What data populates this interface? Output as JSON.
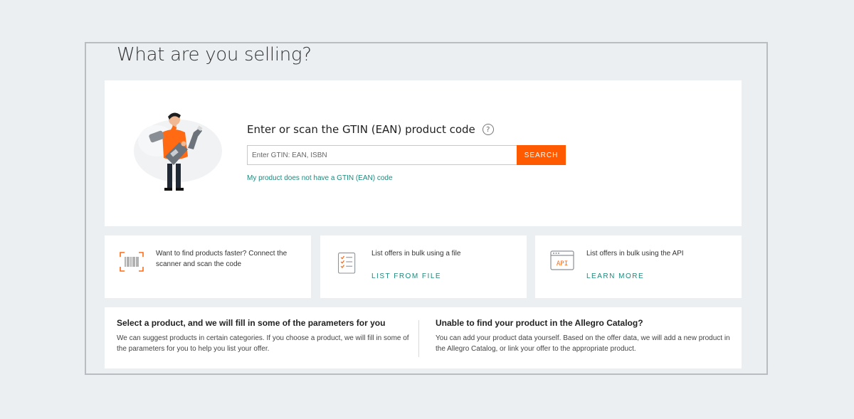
{
  "page": {
    "title": "What are you selling?"
  },
  "gtin": {
    "heading": "Enter or scan the GTIN (EAN) product code",
    "help_icon": "question-circle-icon",
    "placeholder": "Enter GTIN: EAN, ISBN",
    "value": "",
    "search_label": "SEARCH",
    "no_gtin_link": "My product does not have a GTIN (EAN) code"
  },
  "tiles": [
    {
      "icon": "barcode-scanner-icon",
      "text": "Want to find products faster? Connect the scanner and scan the code",
      "link": ""
    },
    {
      "icon": "checklist-file-icon",
      "text": "List offers in bulk using a file",
      "link": "LIST FROM FILE"
    },
    {
      "icon": "api-window-icon",
      "text": "List offers in bulk using the API",
      "link": "LEARN MORE"
    }
  ],
  "info": {
    "left": {
      "title": "Select a product, and we will fill in some of the parameters for you",
      "body": "We can suggest products in certain categories. If you choose a product, we will fill in some of the parameters for you to help you list your offer."
    },
    "right": {
      "title": "Unable to find your product in the Allegro Catalog?",
      "body": "You can add your product data yourself. Based on the offer data, we will add a new product in the Allegro Catalog, or link your offer to the appropriate product."
    }
  },
  "colors": {
    "accent": "#ff5a00",
    "link": "#1d8a7e",
    "background": "#eceff2"
  }
}
